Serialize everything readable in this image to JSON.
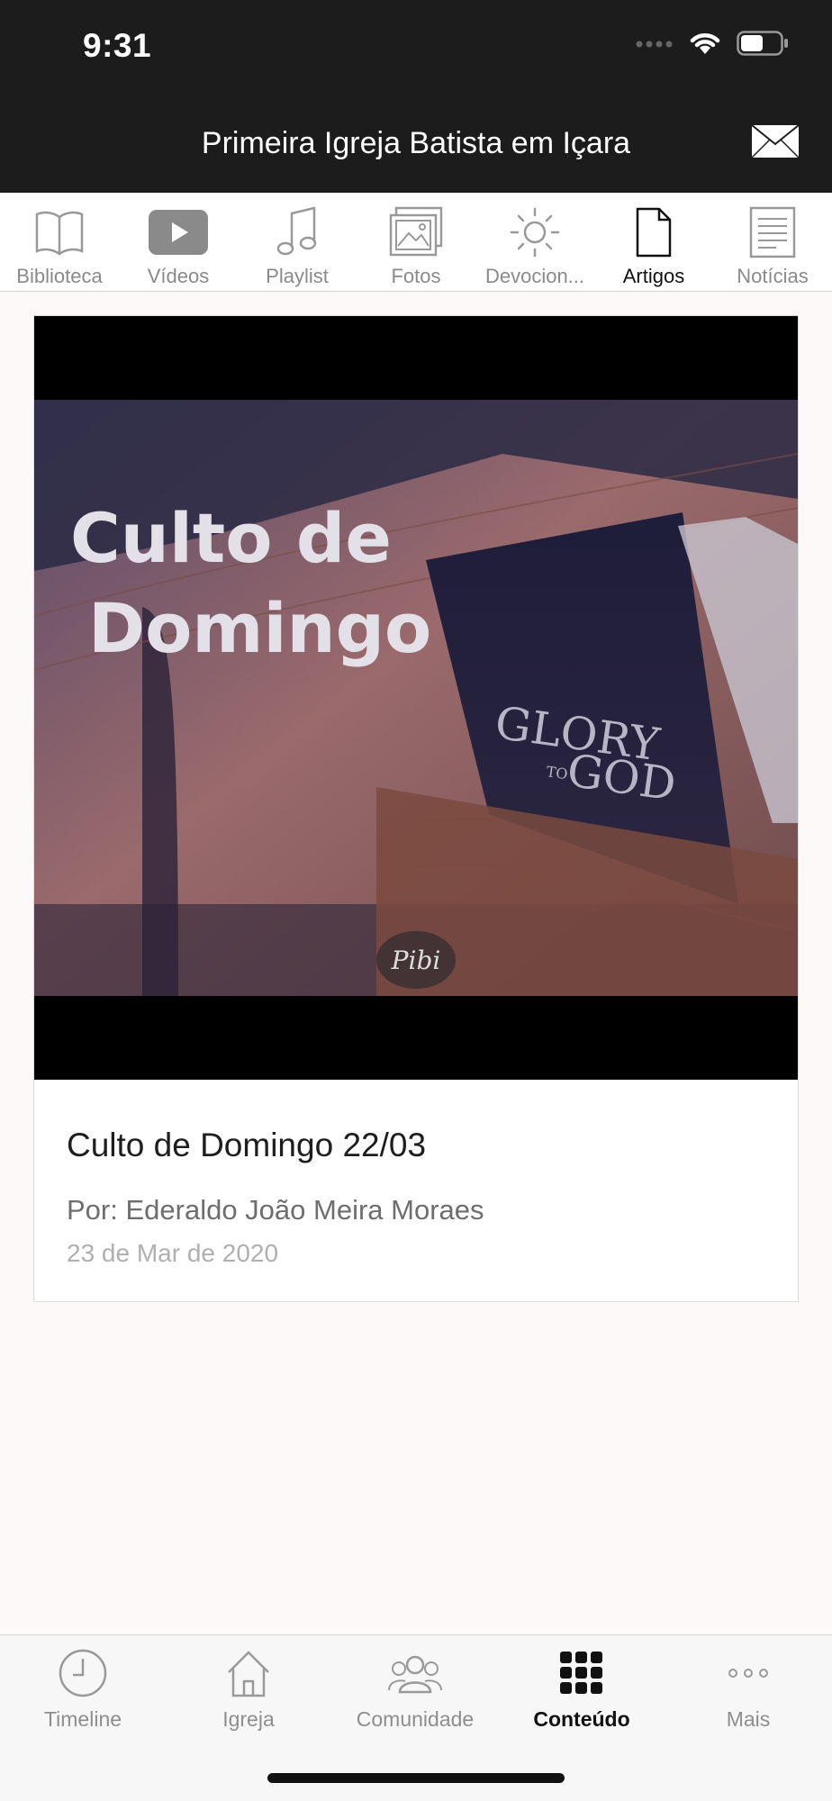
{
  "status": {
    "time": "9:31"
  },
  "header": {
    "title": "Primeira Igreja Batista em Içara"
  },
  "categories": [
    {
      "label": "Biblioteca",
      "icon": "book-icon"
    },
    {
      "label": "Vídeos",
      "icon": "play-icon"
    },
    {
      "label": "Playlist",
      "icon": "music-note-icon"
    },
    {
      "label": "Fotos",
      "icon": "photos-icon"
    },
    {
      "label": "Devocion...",
      "icon": "sun-icon"
    },
    {
      "label": "Artigos",
      "icon": "document-icon",
      "active": true
    },
    {
      "label": "Notícias",
      "icon": "newspaper-icon"
    }
  ],
  "article": {
    "image_text_line1": "Culto de",
    "image_text_line2": "Domingo",
    "image_book_text1": "GLORY",
    "image_book_text2": "TO",
    "image_book_text3": "GOD",
    "image_logo": "Pibi",
    "title": "Culto de Domingo 22/03",
    "author": "Por: Ederaldo João Meira Moraes",
    "date": "23 de Mar de 2020"
  },
  "tabs": [
    {
      "label": "Timeline",
      "icon": "clock-icon"
    },
    {
      "label": "Igreja",
      "icon": "church-icon"
    },
    {
      "label": "Comunidade",
      "icon": "people-icon"
    },
    {
      "label": "Conteúdo",
      "icon": "grid-icon",
      "active": true
    },
    {
      "label": "Mais",
      "icon": "more-icon"
    }
  ],
  "colors": {
    "bar": "#1c1c1c",
    "active": "#111111",
    "inactive": "#8e8e8e",
    "background": "#fdf9f8"
  }
}
